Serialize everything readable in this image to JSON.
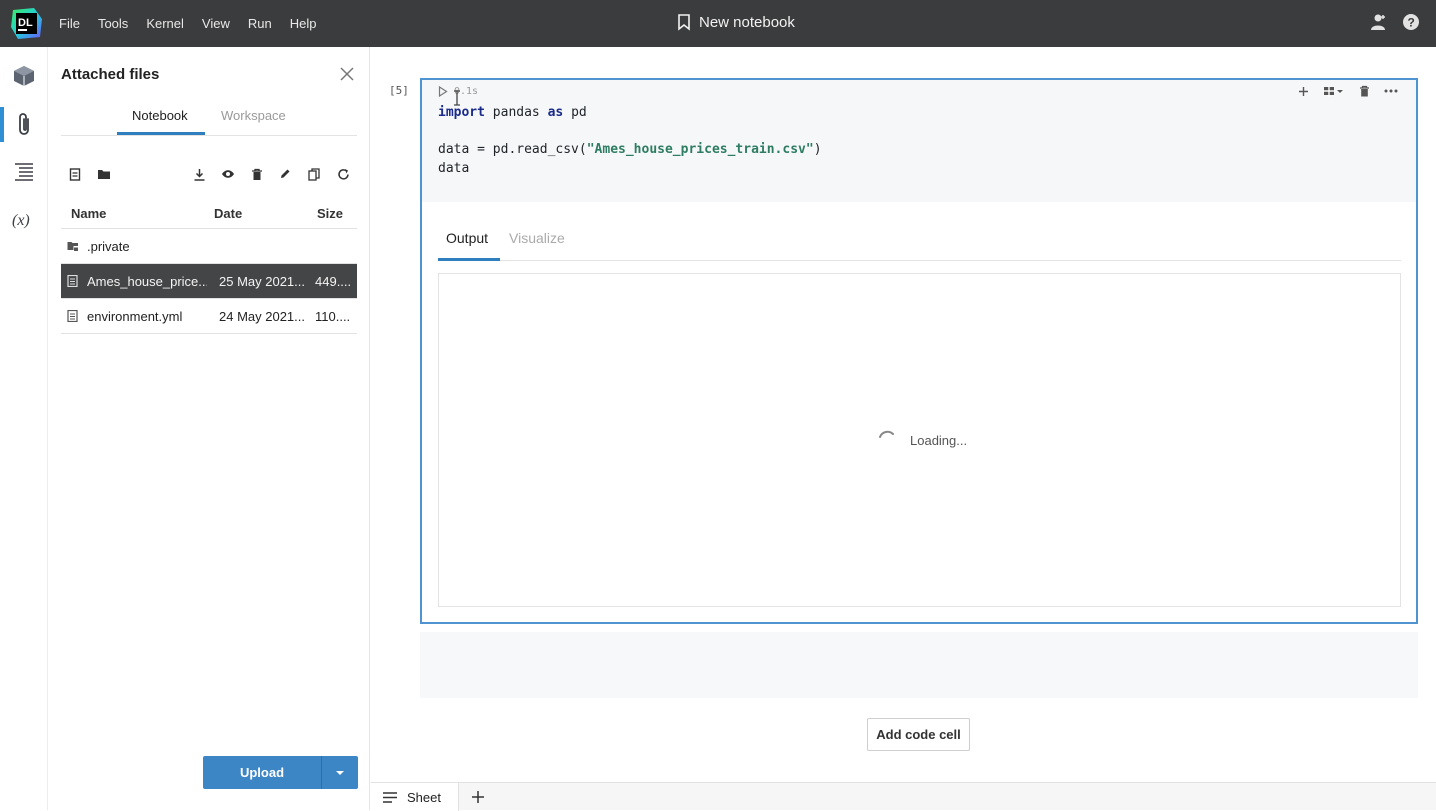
{
  "app": {
    "logo_text": "DL",
    "menu": [
      "File",
      "Tools",
      "Kernel",
      "View",
      "Run",
      "Help"
    ],
    "title": "New notebook"
  },
  "sidebar": {
    "title": "Attached files",
    "tabs": [
      {
        "label": "Notebook",
        "active": true
      },
      {
        "label": "Workspace",
        "active": false
      }
    ],
    "columns": [
      "Name",
      "Date",
      "Size"
    ],
    "files": [
      {
        "name": ".private",
        "date": "",
        "size": "",
        "type": "folder",
        "selected": false
      },
      {
        "name": "Ames_house_price...",
        "date": "25 May 2021...",
        "size": "449....",
        "type": "file",
        "selected": true
      },
      {
        "name": "environment.yml",
        "date": "24 May 2021...",
        "size": "110....",
        "type": "file",
        "selected": false
      }
    ],
    "upload_label": "Upload"
  },
  "cell": {
    "execution_count": "[5]",
    "timing": "0.1s",
    "code_lines": [
      [
        {
          "t": "import",
          "k": "kw"
        },
        {
          "t": " pandas ",
          "k": ""
        },
        {
          "t": "as",
          "k": "kw"
        },
        {
          "t": " pd",
          "k": ""
        }
      ],
      [],
      [
        {
          "t": "data = pd.read_csv(",
          "k": ""
        },
        {
          "t": "\"Ames_house_prices_train.csv\"",
          "k": "str"
        },
        {
          "t": ")",
          "k": ""
        }
      ],
      [
        {
          "t": "data",
          "k": ""
        }
      ]
    ],
    "output_tabs": [
      {
        "label": "Output",
        "active": true
      },
      {
        "label": "Visualize",
        "active": false
      }
    ],
    "loading_text": "Loading..."
  },
  "add_code_cell_label": "Add code cell",
  "bottom": {
    "sheet_label": "Sheet"
  },
  "colors": {
    "accent": "#3d86c6",
    "topbar": "#3b3c3e",
    "selected_row": "#444547",
    "cell_border": "#4f93d1"
  }
}
